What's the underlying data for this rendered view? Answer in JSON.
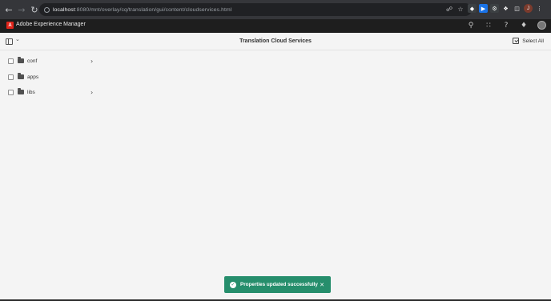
{
  "browser": {
    "url_host": "localhost",
    "url_path": ":8080/mnt/overlay/cq/translation/gui/content/cloudservices.html",
    "back_icon": "arrow-left-icon",
    "forward_icon": "arrow-right-icon",
    "reload_icon": "reload-icon",
    "profile_initial": "J"
  },
  "aem": {
    "product_name": "Adobe Experience Manager",
    "logo_glyph": "A",
    "brand_color": "#e1251b"
  },
  "action_bar": {
    "title": "Translation Cloud Services",
    "select_all_label": "Select All"
  },
  "column": {
    "items": [
      {
        "label": "conf",
        "has_children": true
      },
      {
        "label": "apps",
        "has_children": false
      },
      {
        "label": "libs",
        "has_children": true
      }
    ]
  },
  "toast": {
    "message": "Properties updated successfully",
    "color": "#268e6c"
  }
}
